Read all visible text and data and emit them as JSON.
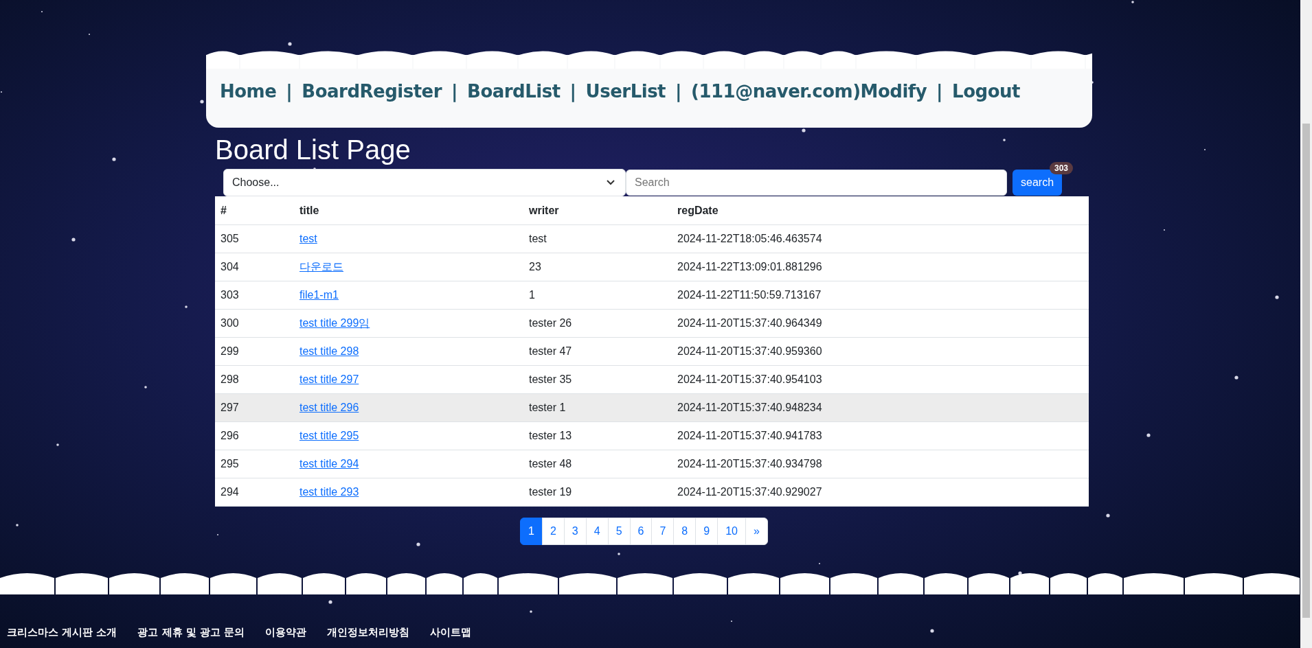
{
  "nav": {
    "items": [
      {
        "label": "Home"
      },
      {
        "label": "BoardRegister"
      },
      {
        "label": "BoardList"
      },
      {
        "label": "UserList"
      },
      {
        "label": "(111@naver.com)Modify"
      },
      {
        "label": "Logout"
      }
    ],
    "separator": "|"
  },
  "page_title": "Board List Page",
  "search": {
    "select": {
      "value": "Choose..."
    },
    "input": {
      "placeholder": "Search"
    },
    "button": "search",
    "badge": "303"
  },
  "table": {
    "columns": [
      "#",
      "title",
      "writer",
      "regDate"
    ],
    "rows": [
      {
        "no": "305",
        "title": "test",
        "writer": "test",
        "regDate": "2024-11-22T18:05:46.463574",
        "highlighted": false
      },
      {
        "no": "304",
        "title": "다운로드",
        "writer": "23",
        "regDate": "2024-11-22T13:09:01.881296",
        "highlighted": false
      },
      {
        "no": "303",
        "title": "file1-m1",
        "writer": "1",
        "regDate": "2024-11-22T11:50:59.713167",
        "highlighted": false
      },
      {
        "no": "300",
        "title": "test title 299임",
        "writer": "tester 26",
        "regDate": "2024-11-20T15:37:40.964349",
        "highlighted": false
      },
      {
        "no": "299",
        "title": "test title 298",
        "writer": "tester 47",
        "regDate": "2024-11-20T15:37:40.959360",
        "highlighted": false
      },
      {
        "no": "298",
        "title": "test title 297",
        "writer": "tester 35",
        "regDate": "2024-11-20T15:37:40.954103",
        "highlighted": false
      },
      {
        "no": "297",
        "title": "test title 296",
        "writer": "tester 1",
        "regDate": "2024-11-20T15:37:40.948234",
        "highlighted": true
      },
      {
        "no": "296",
        "title": "test title 295",
        "writer": "tester 13",
        "regDate": "2024-11-20T15:37:40.941783",
        "highlighted": false
      },
      {
        "no": "295",
        "title": "test title 294",
        "writer": "tester 48",
        "regDate": "2024-11-20T15:37:40.934798",
        "highlighted": false
      },
      {
        "no": "294",
        "title": "test title 293",
        "writer": "tester 19",
        "regDate": "2024-11-20T15:37:40.929027",
        "highlighted": false
      }
    ]
  },
  "pagination": [
    {
      "label": "1",
      "selected": true
    },
    {
      "label": "2",
      "selected": false
    },
    {
      "label": "3",
      "selected": false
    },
    {
      "label": "4",
      "selected": false
    },
    {
      "label": "5",
      "selected": false
    },
    {
      "label": "6",
      "selected": false
    },
    {
      "label": "7",
      "selected": false
    },
    {
      "label": "8",
      "selected": false
    },
    {
      "label": "9",
      "selected": false
    },
    {
      "label": "10",
      "selected": false
    },
    {
      "label": "»",
      "selected": false
    }
  ],
  "footer": {
    "links": [
      "크리스마스 게시판 소개",
      "광고 제휴 및 광고 문의",
      "이용약관",
      "개인정보처리방침",
      "사이트맵"
    ]
  }
}
